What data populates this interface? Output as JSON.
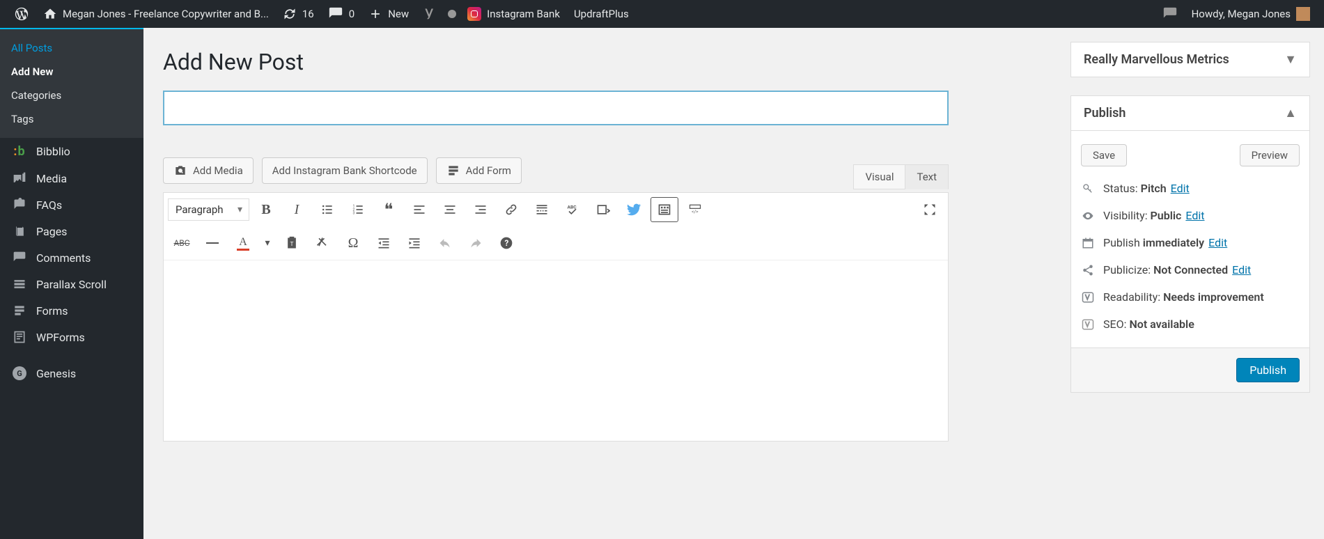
{
  "toolbar": {
    "site_title": "Megan Jones - Freelance Copywriter and B...",
    "updates": "16",
    "comments": "0",
    "new": "New",
    "instagram": "Instagram Bank",
    "updraft": "UpdraftPlus",
    "howdy": "Howdy, Megan Jones"
  },
  "sidebar": {
    "sub": {
      "all_posts": "All Posts",
      "add_new": "Add New",
      "categories": "Categories",
      "tags": "Tags"
    },
    "items": {
      "bibblio": "Bibblio",
      "media": "Media",
      "faqs": "FAQs",
      "pages": "Pages",
      "comments": "Comments",
      "parallax": "Parallax Scroll",
      "forms": "Forms",
      "wpforms": "WPForms",
      "genesis": "Genesis"
    }
  },
  "main": {
    "page_title": "Add New Post",
    "title_placeholder": "",
    "buttons": {
      "add_media": "Add Media",
      "add_instagram": "Add Instagram Bank Shortcode",
      "add_form": "Add Form"
    },
    "tabs": {
      "visual": "Visual",
      "text": "Text"
    },
    "format": "Paragraph"
  },
  "boxes": {
    "metrics": {
      "title": "Really Marvellous Metrics"
    },
    "publish": {
      "title": "Publish",
      "save": "Save",
      "preview": "Preview",
      "status_label": "Status:",
      "status_value": "Pitch",
      "edit": "Edit",
      "visibility_label": "Visibility:",
      "visibility_value": "Public",
      "publish_label": "Publish",
      "publish_value": "immediately",
      "publicize_label": "Publicize:",
      "publicize_value": "Not Connected",
      "readability_label": "Readability:",
      "readability_value": "Needs improvement",
      "seo_label": "SEO:",
      "seo_value": "Not available",
      "publish_btn": "Publish"
    }
  }
}
